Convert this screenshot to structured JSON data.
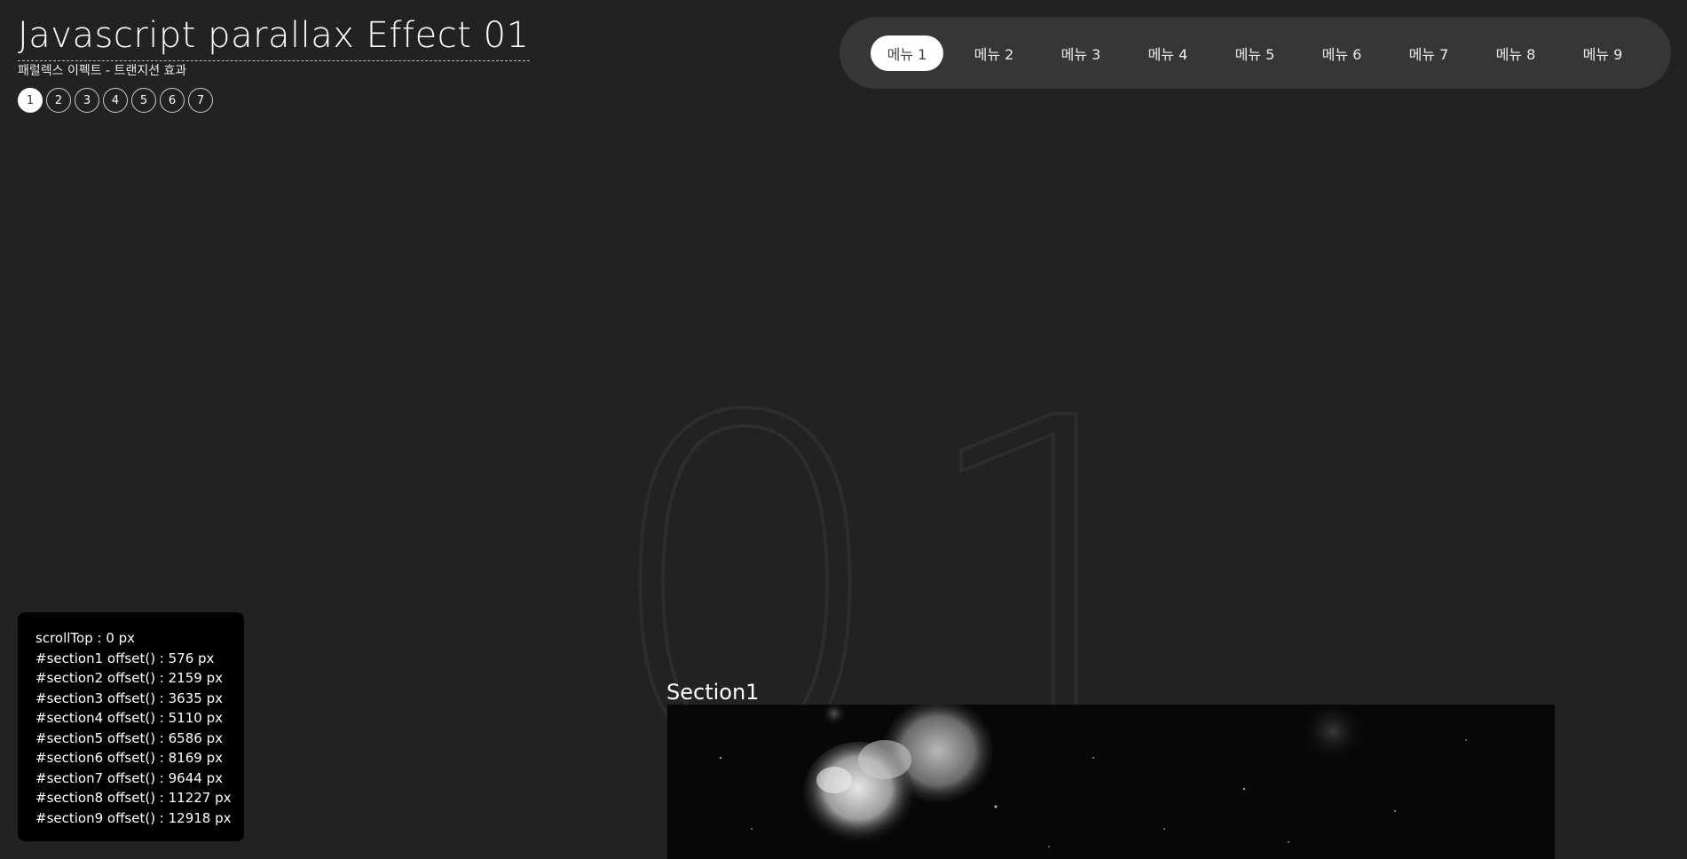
{
  "header": {
    "title": "Javascript parallax Effect 01",
    "subtitle": "패럴렉스 이펙트 - 트랜지션 효과"
  },
  "dots": [
    "1",
    "2",
    "3",
    "4",
    "5",
    "6",
    "7"
  ],
  "nav": {
    "items": [
      "메뉴 1",
      "메뉴 2",
      "메뉴 3",
      "메뉴 4",
      "메뉴 5",
      "메뉴 6",
      "메뉴 7",
      "메뉴 8",
      "메뉴 9"
    ],
    "active_index": 0
  },
  "background_number": "01",
  "section": {
    "label": "Section1"
  },
  "info": {
    "scroll_top": "scrollTop : 0 px",
    "offsets": [
      "#section1 offset() : 576 px",
      "#section2 offset() : 2159 px",
      "#section3 offset() : 3635 px",
      "#section4 offset() : 5110 px",
      "#section5 offset() : 6586 px",
      "#section6 offset() : 8169 px",
      "#section7 offset() : 9644 px",
      "#section8 offset() : 11227 px",
      "#section9 offset() : 12918 px"
    ]
  },
  "colors": {
    "background": "#222222",
    "nav_background": "#363636",
    "active": "#ffffff",
    "panel": "#000000"
  }
}
